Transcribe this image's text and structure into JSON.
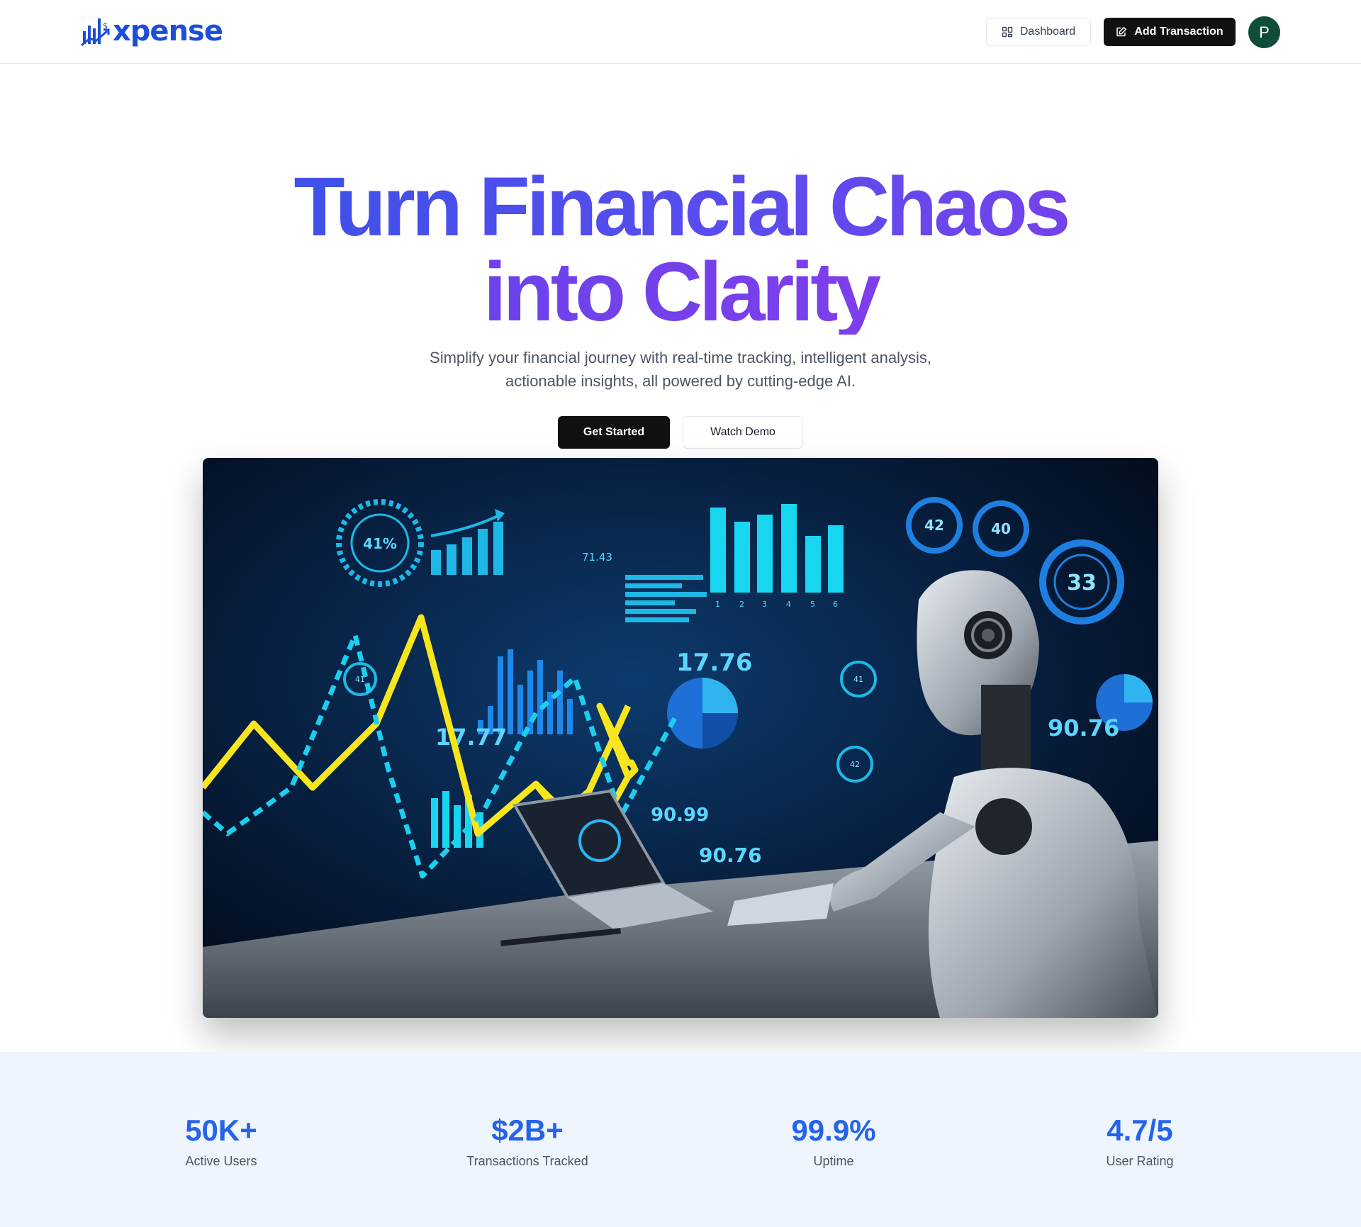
{
  "brand": {
    "name": "xpense",
    "accent": "#1d4ed8"
  },
  "header": {
    "dashboard_label": "Dashboard",
    "add_transaction_label": "Add Transaction",
    "avatar_initial": "P",
    "avatar_color": "#0f4c3a"
  },
  "hero": {
    "headline_line1": "Turn Financial Chaos",
    "headline_line2": "into Clarity",
    "subtitle": "Simplify your financial journey with real-time tracking, intelligent analysis, actionable insights, all powered by cutting-edge AI.",
    "primary_cta": "Get Started",
    "secondary_cta": "Watch Demo",
    "gradient": [
      "#2d53e6",
      "#5b4cee",
      "#8a3ae9"
    ]
  },
  "hero_image": {
    "labels": {
      "gauge_pct": "41%",
      "value_top": "71.43",
      "value_mid": "17.76",
      "value_left": "17.77",
      "value_right": "90.76",
      "value_bottom": "90.99",
      "value_bottom2": "90.76",
      "ring_a": "42",
      "ring_b": "40",
      "ring_c": "33",
      "small_ring_a": "41",
      "small_ring_b": "41",
      "small_ring_c": "42",
      "bar_axis": [
        "1",
        "2",
        "3",
        "4",
        "5",
        "6"
      ]
    }
  },
  "stats": [
    {
      "value": "50K+",
      "label": "Active Users"
    },
    {
      "value": "$2B+",
      "label": "Transactions Tracked"
    },
    {
      "value": "99.9%",
      "label": "Uptime"
    },
    {
      "value": "4.7/5",
      "label": "User Rating"
    }
  ]
}
